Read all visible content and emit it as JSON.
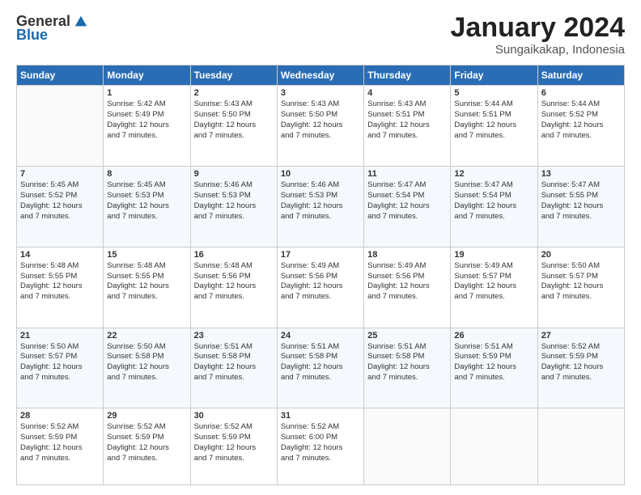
{
  "logo": {
    "general": "General",
    "blue": "Blue"
  },
  "header": {
    "month": "January 2024",
    "location": "Sungaikakap, Indonesia"
  },
  "weekdays": [
    "Sunday",
    "Monday",
    "Tuesday",
    "Wednesday",
    "Thursday",
    "Friday",
    "Saturday"
  ],
  "weeks": [
    [
      {
        "day": "",
        "info": ""
      },
      {
        "day": "1",
        "info": "Sunrise: 5:42 AM\nSunset: 5:49 PM\nDaylight: 12 hours\nand 7 minutes."
      },
      {
        "day": "2",
        "info": "Sunrise: 5:43 AM\nSunset: 5:50 PM\nDaylight: 12 hours\nand 7 minutes."
      },
      {
        "day": "3",
        "info": "Sunrise: 5:43 AM\nSunset: 5:50 PM\nDaylight: 12 hours\nand 7 minutes."
      },
      {
        "day": "4",
        "info": "Sunrise: 5:43 AM\nSunset: 5:51 PM\nDaylight: 12 hours\nand 7 minutes."
      },
      {
        "day": "5",
        "info": "Sunrise: 5:44 AM\nSunset: 5:51 PM\nDaylight: 12 hours\nand 7 minutes."
      },
      {
        "day": "6",
        "info": "Sunrise: 5:44 AM\nSunset: 5:52 PM\nDaylight: 12 hours\nand 7 minutes."
      }
    ],
    [
      {
        "day": "7",
        "info": "Sunrise: 5:45 AM\nSunset: 5:52 PM\nDaylight: 12 hours\nand 7 minutes."
      },
      {
        "day": "8",
        "info": "Sunrise: 5:45 AM\nSunset: 5:53 PM\nDaylight: 12 hours\nand 7 minutes."
      },
      {
        "day": "9",
        "info": "Sunrise: 5:46 AM\nSunset: 5:53 PM\nDaylight: 12 hours\nand 7 minutes."
      },
      {
        "day": "10",
        "info": "Sunrise: 5:46 AM\nSunset: 5:53 PM\nDaylight: 12 hours\nand 7 minutes."
      },
      {
        "day": "11",
        "info": "Sunrise: 5:47 AM\nSunset: 5:54 PM\nDaylight: 12 hours\nand 7 minutes."
      },
      {
        "day": "12",
        "info": "Sunrise: 5:47 AM\nSunset: 5:54 PM\nDaylight: 12 hours\nand 7 minutes."
      },
      {
        "day": "13",
        "info": "Sunrise: 5:47 AM\nSunset: 5:55 PM\nDaylight: 12 hours\nand 7 minutes."
      }
    ],
    [
      {
        "day": "14",
        "info": "Sunrise: 5:48 AM\nSunset: 5:55 PM\nDaylight: 12 hours\nand 7 minutes."
      },
      {
        "day": "15",
        "info": "Sunrise: 5:48 AM\nSunset: 5:55 PM\nDaylight: 12 hours\nand 7 minutes."
      },
      {
        "day": "16",
        "info": "Sunrise: 5:48 AM\nSunset: 5:56 PM\nDaylight: 12 hours\nand 7 minutes."
      },
      {
        "day": "17",
        "info": "Sunrise: 5:49 AM\nSunset: 5:56 PM\nDaylight: 12 hours\nand 7 minutes."
      },
      {
        "day": "18",
        "info": "Sunrise: 5:49 AM\nSunset: 5:56 PM\nDaylight: 12 hours\nand 7 minutes."
      },
      {
        "day": "19",
        "info": "Sunrise: 5:49 AM\nSunset: 5:57 PM\nDaylight: 12 hours\nand 7 minutes."
      },
      {
        "day": "20",
        "info": "Sunrise: 5:50 AM\nSunset: 5:57 PM\nDaylight: 12 hours\nand 7 minutes."
      }
    ],
    [
      {
        "day": "21",
        "info": "Sunrise: 5:50 AM\nSunset: 5:57 PM\nDaylight: 12 hours\nand 7 minutes."
      },
      {
        "day": "22",
        "info": "Sunrise: 5:50 AM\nSunset: 5:58 PM\nDaylight: 12 hours\nand 7 minutes."
      },
      {
        "day": "23",
        "info": "Sunrise: 5:51 AM\nSunset: 5:58 PM\nDaylight: 12 hours\nand 7 minutes."
      },
      {
        "day": "24",
        "info": "Sunrise: 5:51 AM\nSunset: 5:58 PM\nDaylight: 12 hours\nand 7 minutes."
      },
      {
        "day": "25",
        "info": "Sunrise: 5:51 AM\nSunset: 5:58 PM\nDaylight: 12 hours\nand 7 minutes."
      },
      {
        "day": "26",
        "info": "Sunrise: 5:51 AM\nSunset: 5:59 PM\nDaylight: 12 hours\nand 7 minutes."
      },
      {
        "day": "27",
        "info": "Sunrise: 5:52 AM\nSunset: 5:59 PM\nDaylight: 12 hours\nand 7 minutes."
      }
    ],
    [
      {
        "day": "28",
        "info": "Sunrise: 5:52 AM\nSunset: 5:59 PM\nDaylight: 12 hours\nand 7 minutes."
      },
      {
        "day": "29",
        "info": "Sunrise: 5:52 AM\nSunset: 5:59 PM\nDaylight: 12 hours\nand 7 minutes."
      },
      {
        "day": "30",
        "info": "Sunrise: 5:52 AM\nSunset: 5:59 PM\nDaylight: 12 hours\nand 7 minutes."
      },
      {
        "day": "31",
        "info": "Sunrise: 5:52 AM\nSunset: 6:00 PM\nDaylight: 12 hours\nand 7 minutes."
      },
      {
        "day": "",
        "info": ""
      },
      {
        "day": "",
        "info": ""
      },
      {
        "day": "",
        "info": ""
      }
    ]
  ]
}
